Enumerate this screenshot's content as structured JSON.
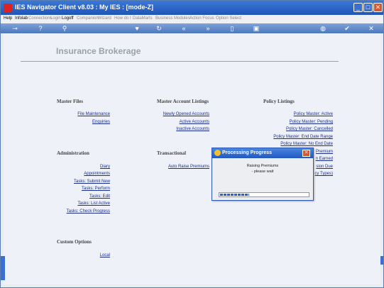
{
  "window": {
    "title": "IES Navigator Client v8.03 : My IES :      [mode-Z]"
  },
  "menu": {
    "items": [
      "Help",
      "Infolab",
      "Connections",
      "Login",
      "Logoff",
      "Companion",
      "Wizard",
      "How do I",
      "DataMarts",
      "Business Modules",
      "Action Focus",
      "Option Select"
    ]
  },
  "toolbar": {
    "icons": [
      "key-icon",
      "help-icon",
      "search-icon",
      "heart-icon",
      "refresh-icon",
      "back-icon",
      "forward-icon",
      "document-icon",
      "pages-icon",
      "globe-icon",
      "check-icon",
      "close-icon"
    ]
  },
  "page": {
    "title": "Insurance Brokerage"
  },
  "sections": {
    "master_files": {
      "heading": "Master Files",
      "links": [
        "File Maintenance",
        "Enquiries"
      ]
    },
    "master_account_listings": {
      "heading": "Master Account Listings",
      "links": [
        "Newly Opened Accounts",
        "Active Accounts",
        "Inactive Accounts"
      ]
    },
    "policy_listings": {
      "heading": "Policy Listings",
      "links": [
        "Policy Master: Active",
        "Policy Master: Pending",
        "Policy Master: Cancelled",
        "Policy Master: End Date Range",
        "Policy Master: No End Date",
        "Premium",
        "n Earned",
        "sion Due",
        "cy Types)"
      ]
    },
    "administration": {
      "heading": "Administration",
      "links": [
        "Diary",
        "Appointments",
        "Tasks: Submit New",
        "Tasks: Perform",
        "Tasks: Edit",
        "Tasks: List Active",
        "Tasks: Check Progress"
      ]
    },
    "transactional": {
      "heading": "Transactional",
      "links": [
        "Auto Raise Premiums"
      ]
    },
    "custom_options": {
      "heading": "Custom Options",
      "links": [
        "Local"
      ]
    }
  },
  "dialog": {
    "title": "Processing Progress",
    "message_line1": "Raising Premiums",
    "message_line2": "- please wait",
    "progress": 0.33
  },
  "colors": {
    "title_bar": "#1f55b8",
    "link": "#1a2d8f",
    "progress": "#2a5fd0"
  }
}
